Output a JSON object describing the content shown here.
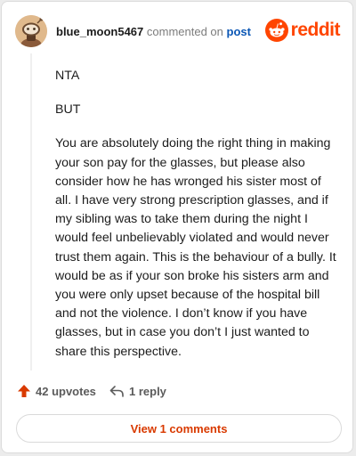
{
  "header": {
    "username": "blue_moon5467",
    "commented_on": "commented on",
    "post_link": "post",
    "logo_text": "reddit"
  },
  "comment": {
    "paragraphs": [
      "NTA",
      "BUT",
      "You are absolutely doing the right thing in making your son pay for the glasses, but please also consider how he has wronged his sister most of all. I have very strong prescription glasses, and if my sibling was to take them during the night I would feel unbelievably violated and would never trust them again. This is the behaviour of a bully. It would be as if your son broke his sisters arm and you were only upset because of the hospital bill and not the violence. I don’t know if you have glasses, but in case you don’t I just wanted to share this perspective."
    ]
  },
  "actions": {
    "upvotes_label": "42 upvotes",
    "reply_label": "1 reply"
  },
  "view_comments_label": "View 1 comments",
  "colors": {
    "brand": "#ff4500",
    "link": "#0b57b5",
    "view_button_text": "#d93a00",
    "upvote_arrow": "#d93a00"
  },
  "icons": {
    "avatar": "snoo-avatar",
    "logo": "reddit-snoo-icon",
    "upvote": "upvote-arrow-icon",
    "reply": "reply-arrow-icon"
  }
}
